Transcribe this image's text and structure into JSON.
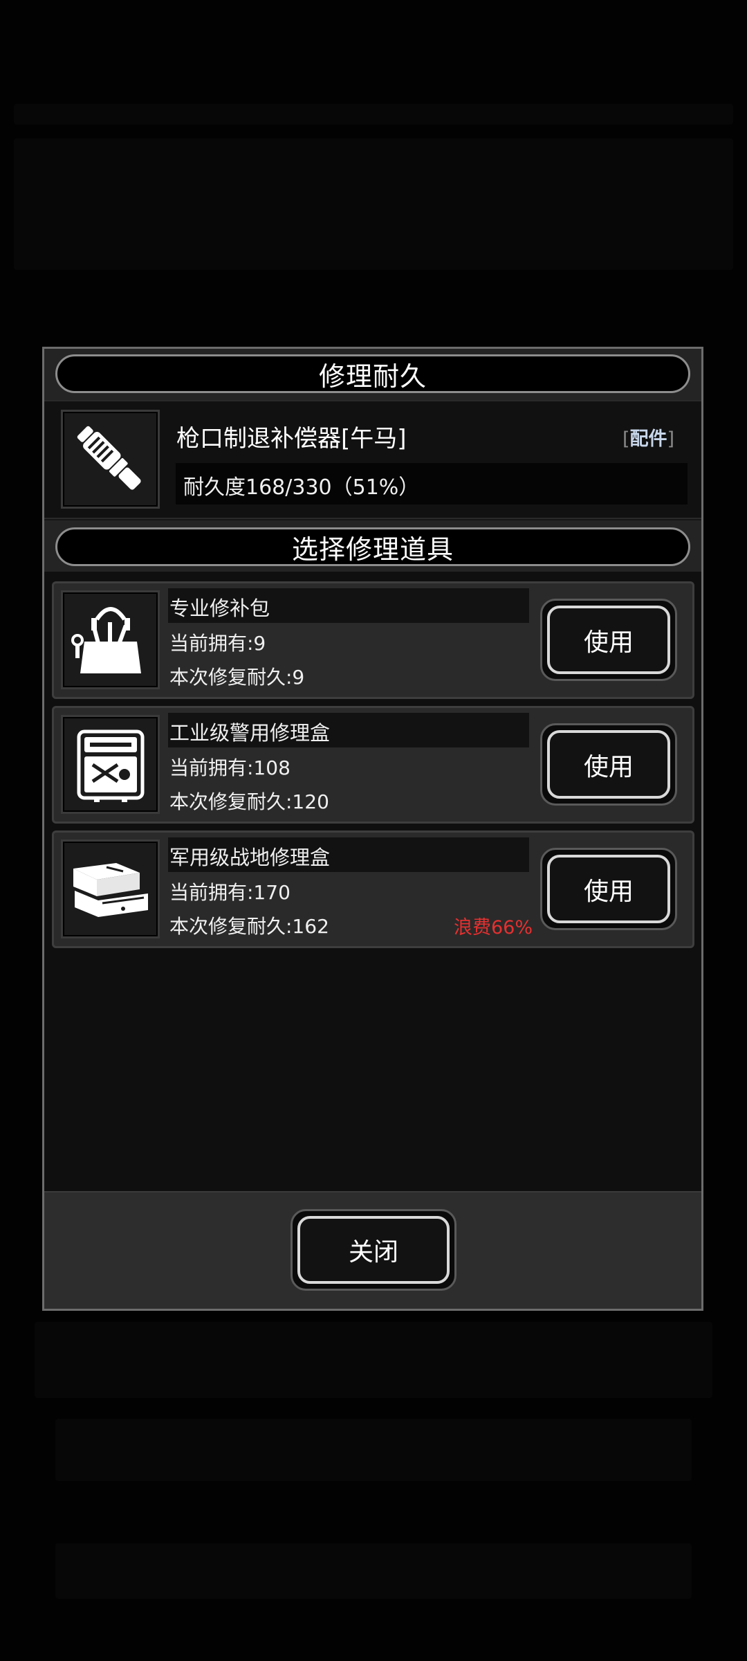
{
  "dialog": {
    "title": "修理耐久",
    "close_label": "关闭"
  },
  "equipment": {
    "name": "枪口制退补偿器[午马]",
    "tag": "配件",
    "tag_open": "[",
    "tag_close": "]",
    "durability_text": "耐久度168/330（51%）",
    "durability_current": 168,
    "durability_max": 330,
    "icon": "muzzle-brake-icon"
  },
  "tools_section": {
    "title": "选择修理道具",
    "use_label": "使用",
    "items": [
      {
        "name": "专业修补包",
        "owned": "当前拥有:9",
        "repair": "本次修复耐久:9",
        "waste": "",
        "icon": "repair-kit-bag-icon"
      },
      {
        "name": "工业级警用修理盒",
        "owned": "当前拥有:108",
        "repair": "本次修复耐久:120",
        "waste": "",
        "icon": "tool-case-icon"
      },
      {
        "name": "军用级战地修理盒",
        "owned": "当前拥有:170",
        "repair": "本次修复耐久:162",
        "waste": "浪费66%",
        "icon": "toolbox-icon"
      }
    ]
  },
  "colors": {
    "waste": "#e53030",
    "tag": "#c8d6ea",
    "dialog_border": "#6c6c6c"
  }
}
